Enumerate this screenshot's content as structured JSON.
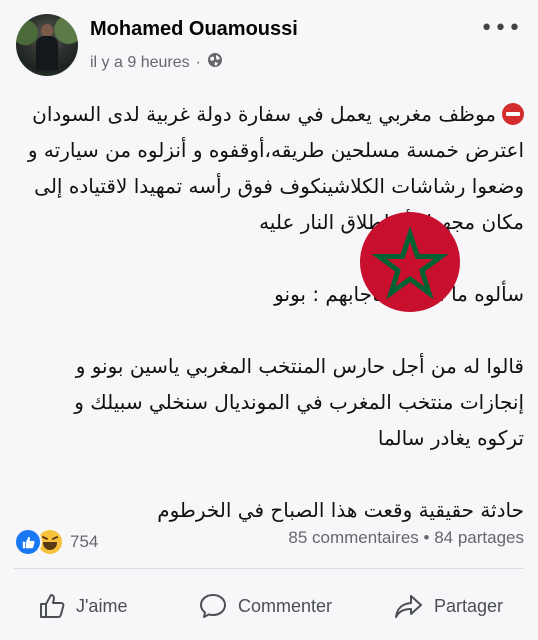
{
  "author": {
    "name": "Mohamed Ouamoussi",
    "time": "il y a 9 heures",
    "privacy_separator": "·",
    "privacy_icon": "globe-icon"
  },
  "post": {
    "lines": [
      "موظف مغربي يعمل في سفارة دولة غربية لدى السودان",
      "اعترض خمسة مسلحين طريقه،أوقفوه و أنزلوه من سيارته و",
      "وضعوا رشاشات الكلاشينكوف فوق رأسه تمهيدا لاقتياده إلى",
      "مكان مجهول أو إطلاق النار عليه",
      "سألوه ما اسمك فأجابهم : بونو",
      "قالوا له من أجل حارس المنتخب المغربي ياسين بونو و",
      "إنجازات منتخب المغرب في المونديال سنخلي سبيلك و",
      "تركوه يغادر  سالما",
      "حادثة حقيقية وقعت هذا الصباح في الخرطوم"
    ],
    "leading_icon": "no-entry-icon",
    "flag": "morocco-flag",
    "flag_colors": {
      "field": "#c8102e",
      "star": "#006233"
    }
  },
  "stats": {
    "reaction_icons": [
      "like-icon",
      "haha-icon"
    ],
    "reaction_count": "754",
    "comments": "85 commentaires",
    "separator": "•",
    "shares": "84 partages"
  },
  "actions": {
    "like_label": "J'aime",
    "comment_label": "Commenter",
    "share_label": "Partager"
  },
  "colors": {
    "like_blue": "#1877f2",
    "haha_yellow": "#f7c23b",
    "text_secondary": "#65676b"
  }
}
